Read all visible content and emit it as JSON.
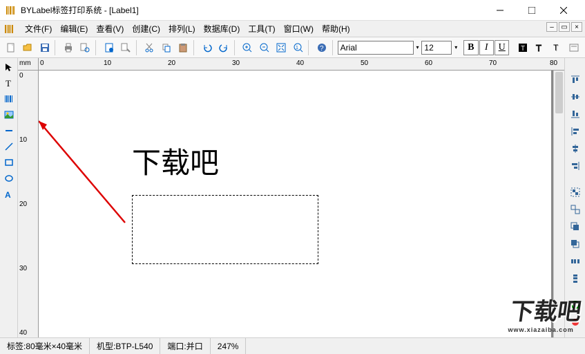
{
  "window": {
    "title": "BYLabel标签打印系统 - [Label1]"
  },
  "menus": {
    "file": "文件(F)",
    "edit": "编辑(E)",
    "view": "查看(V)",
    "create": "创建(C)",
    "arrange": "排列(L)",
    "database": "数据库(D)",
    "tools": "工具(T)",
    "window": "窗口(W)",
    "help": "帮助(H)"
  },
  "font": {
    "name": "Arial",
    "size": "12"
  },
  "ruler": {
    "unit": "mm",
    "hticks": [
      "0",
      "10",
      "20",
      "30",
      "40",
      "50",
      "60",
      "70",
      "80"
    ],
    "vticks": [
      "0",
      "10",
      "20",
      "30",
      "40"
    ]
  },
  "canvas": {
    "text": "下载吧"
  },
  "status": {
    "labelsize": "标签:80毫米×40毫米",
    "model": "机型:BTP-L540",
    "port": "端口:并口",
    "zoom": "247%"
  },
  "watermark": {
    "text": "下载吧",
    "url": "www.xiazaiba.com"
  }
}
